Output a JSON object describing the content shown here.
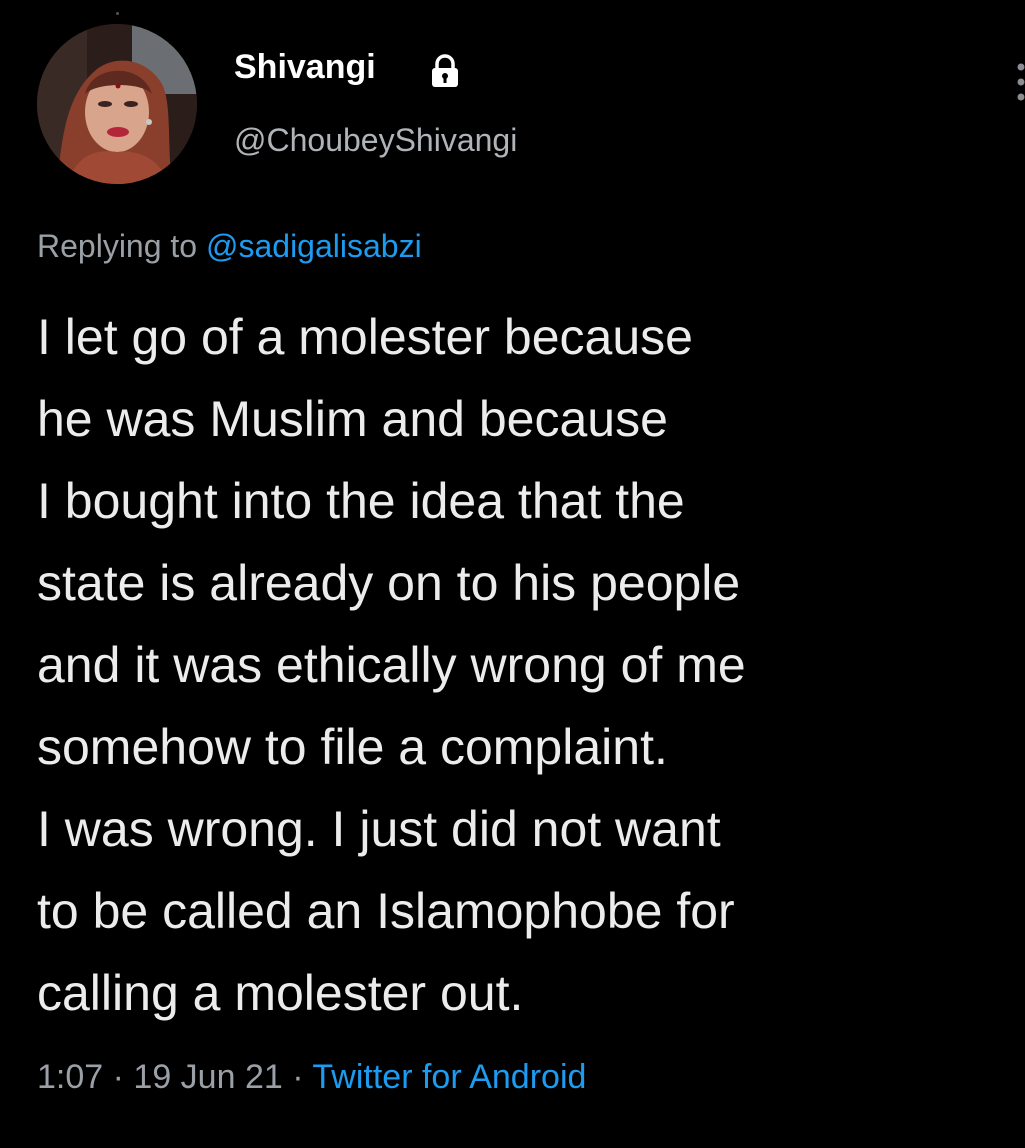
{
  "user": {
    "display_name": "Shivangi",
    "handle": "@ChoubeyShivangi",
    "protected_icon": "lock-icon",
    "avatar_icon": "profile-photo"
  },
  "reply": {
    "prefix": "Replying to",
    "mention": "@sadigalisabzi"
  },
  "tweet": {
    "lines": [
      "I let go of a molester because",
      "he was Muslim and because",
      "I bought into the idea that the",
      "state is already on to his people",
      "and it was ethically wrong of me",
      "somehow to file a complaint.",
      "I was wrong. I just did not want",
      "to be called an Islamophobe for",
      "calling a molester out."
    ]
  },
  "meta": {
    "time": "1:07",
    "separator": "·",
    "date": "19 Jun 21",
    "source": "Twitter for Android"
  },
  "menu": {
    "icon": "more-vertical-icon"
  },
  "colors": {
    "background": "#000000",
    "text": "#ececec",
    "secondary": "#9aa0a6",
    "accent": "#1d9bf0"
  }
}
